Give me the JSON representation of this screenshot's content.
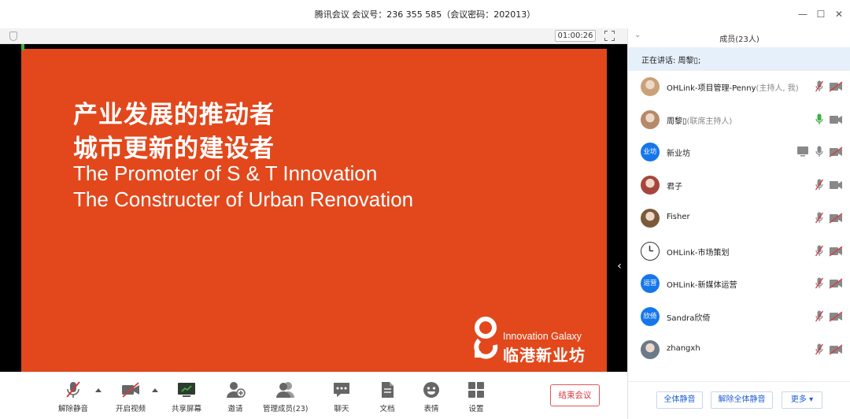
{
  "window": {
    "title": "腾讯会议 会议号：236 355 585（会议密码：202013）",
    "minimize": "—",
    "maximize": "☐",
    "close": "✕"
  },
  "stage_bar": {
    "timer": "01:00:26"
  },
  "slide": {
    "line_cn_1": "产业发展的推动者",
    "line_cn_2": "城市更新的建设者",
    "line_en_1": "The Promoter of S & T Innovation",
    "line_en_2": "The Constructer of Urban Renovation",
    "logo_en": "Innovation Galaxy",
    "logo_cn": "临港新业坊"
  },
  "toolbar": {
    "unmute_label": "解除静音",
    "video_label": "开启视频",
    "share_label": "共享屏幕",
    "invite_label": "邀请",
    "members_label": "管理成员(23)",
    "chat_label": "聊天",
    "docs_label": "文档",
    "emoji_label": "表情",
    "settings_label": "设置",
    "end_label": "结束会议"
  },
  "panel": {
    "title": "成员(23人)",
    "speaking": "正在讲话: 周黎▯;",
    "members": [
      {
        "name": "OHLink-项目管理-Penny",
        "role": "(主持人, 我)",
        "avatar_text": "",
        "avatar_kind": "photo",
        "mic": "muted",
        "cam": "off",
        "sharing": false
      },
      {
        "name": "周黎▯",
        "role": "(联席主持人)",
        "avatar_text": "",
        "avatar_kind": "photo",
        "mic": "active",
        "cam": "on",
        "sharing": false
      },
      {
        "name": "新业坊",
        "role": "",
        "avatar_text": "业坊",
        "avatar_kind": "blue",
        "mic": "on",
        "cam": "off",
        "sharing": true
      },
      {
        "name": "君子",
        "role": "",
        "avatar_text": "",
        "avatar_kind": "photo",
        "mic": "muted",
        "cam": "on",
        "sharing": false
      },
      {
        "name": "Fisher",
        "role": "",
        "avatar_text": "",
        "avatar_kind": "photo",
        "mic": "muted",
        "cam": "off",
        "sharing": false
      },
      {
        "name": "OHLink-市场策划",
        "role": "",
        "avatar_text": "",
        "avatar_kind": "clock",
        "mic": "muted",
        "cam": "off",
        "sharing": false
      },
      {
        "name": "OHLink-新媒体运营",
        "role": "",
        "avatar_text": "运营",
        "avatar_kind": "blue",
        "mic": "muted",
        "cam": "off",
        "sharing": false
      },
      {
        "name": "Sandra欣倚",
        "role": "",
        "avatar_text": "欣倚",
        "avatar_kind": "blue",
        "mic": "muted",
        "cam": "off",
        "sharing": false
      },
      {
        "name": "zhangxh",
        "role": "",
        "avatar_text": "",
        "avatar_kind": "photo",
        "mic": "muted",
        "cam": "off",
        "sharing": false
      }
    ],
    "mute_all": "全体静音",
    "unmute_all": "解除全体静音",
    "more": "更多 ▾"
  },
  "colors": {
    "slide_bg": "#e2481c",
    "accent_blue": "#1677ea",
    "end_red": "#d9363e",
    "mic_active": "#3cb043",
    "muted_red": "#d9363e"
  }
}
